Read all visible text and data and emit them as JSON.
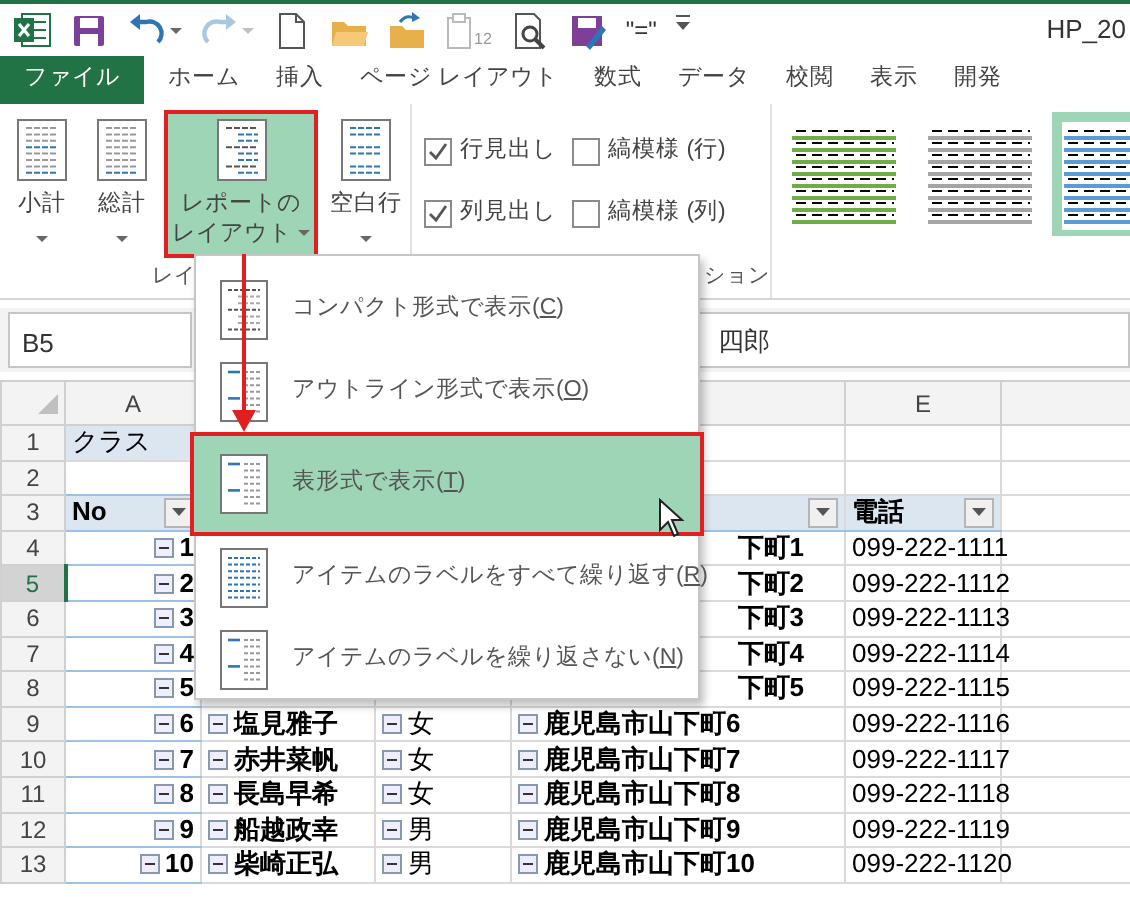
{
  "quick_access": {
    "tools": [
      {
        "kind": "excel"
      },
      {
        "kind": "save"
      },
      {
        "kind": "undo",
        "caret": true
      },
      {
        "kind": "redo",
        "caret": true,
        "disabled": true
      },
      {
        "kind": "new"
      },
      {
        "kind": "open"
      },
      {
        "kind": "folder-up"
      },
      {
        "kind": "clipboard",
        "disabled": true,
        "text": "12"
      },
      {
        "kind": "preview"
      },
      {
        "kind": "form"
      },
      {
        "kind": "text",
        "text": "\"=\""
      },
      {
        "kind": "customize"
      }
    ],
    "title": "HP_20"
  },
  "tabs": [
    {
      "label": "ファイル",
      "kind": "file"
    },
    {
      "label": "ホーム",
      "kind": "tab"
    },
    {
      "label": "挿入",
      "kind": "tab"
    },
    {
      "label": "ページ レイアウト",
      "kind": "tab"
    },
    {
      "label": "数式",
      "kind": "tab"
    },
    {
      "label": "データ",
      "kind": "tab"
    },
    {
      "label": "校閲",
      "kind": "tab"
    },
    {
      "label": "表示",
      "kind": "tab"
    },
    {
      "label": "開発",
      "kind": "tab"
    }
  ],
  "ribbon": {
    "buttons": [
      {
        "label": [
          "小計"
        ],
        "caret": true,
        "selected": false
      },
      {
        "label": [
          "総計"
        ],
        "caret": true,
        "selected": false
      },
      {
        "label": [
          "レポートの",
          "レイアウト"
        ],
        "caret": true,
        "selected": true
      },
      {
        "label": [
          "空白行"
        ],
        "caret": true,
        "selected": false
      }
    ],
    "group_label_1": "レイ",
    "checkboxes": [
      {
        "label": "行見出し",
        "checked": true
      },
      {
        "label": "縞模様 (行)",
        "checked": false
      },
      {
        "label": "列見出し",
        "checked": true
      },
      {
        "label": "縞模様 (列)",
        "checked": false
      }
    ],
    "group_label_2": "ション",
    "styles": [
      {
        "color": "#70ad47",
        "selected": false
      },
      {
        "color": "#a5a5a5",
        "selected": false
      },
      {
        "color": "#5b9bd5",
        "selected": true
      }
    ]
  },
  "menu": {
    "items": [
      {
        "kind": "compact",
        "parts": [
          "コンパクト形式で表示(",
          "C",
          ")"
        ],
        "selected": false
      },
      {
        "kind": "outline",
        "parts": [
          "アウトライン形式で表示(",
          "O",
          ")"
        ],
        "selected": false
      },
      {
        "kind": "tabular",
        "parts": [
          "表形式で表示(",
          "T",
          ")"
        ],
        "selected": true
      },
      {
        "kind": "repeat",
        "parts": [
          "アイテムのラベルをすべて繰り返す(",
          "R",
          ")"
        ],
        "selected": false
      },
      {
        "kind": "norepeat",
        "parts": [
          "アイテムのラベルを繰り返さない(",
          "N",
          ")"
        ],
        "selected": false
      }
    ]
  },
  "formula_bar": {
    "name_box": "B5",
    "content": "四郎"
  },
  "sheet": {
    "columns": [
      {
        "letter": "A"
      },
      {},
      {},
      {},
      {
        "letter": "E"
      },
      {}
    ],
    "rows": [
      {
        "number": "1",
        "selected": false,
        "kind": "label",
        "cells": [
          {
            "text": "クラス"
          },
          {},
          {},
          {},
          {},
          {}
        ]
      },
      {
        "number": "2",
        "selected": false,
        "kind": "data",
        "cells": [
          {},
          {},
          {},
          {},
          {},
          {}
        ]
      },
      {
        "number": "3",
        "selected": false,
        "kind": "header",
        "cells": [
          {
            "text": "No",
            "bold": true,
            "filter": true
          },
          {},
          {},
          {
            "filter": true
          },
          {
            "text": "電話",
            "bold": true,
            "filter": true
          },
          {}
        ]
      },
      {
        "number": "4",
        "selected": false,
        "kind": "data",
        "cells": [
          {
            "text": "1",
            "bold": true,
            "outline": true
          },
          {},
          {},
          {
            "text": "下町1",
            "bold": true,
            "partial": true
          },
          {
            "text": "099-222-1111"
          },
          {}
        ]
      },
      {
        "number": "5",
        "selected": true,
        "kind": "data",
        "cells": [
          {
            "text": "2",
            "bold": true,
            "outline": true
          },
          {},
          {},
          {
            "text": "下町2",
            "bold": true,
            "partial": true
          },
          {
            "text": "099-222-1112"
          },
          {}
        ]
      },
      {
        "number": "6",
        "selected": false,
        "kind": "data",
        "cells": [
          {
            "text": "3",
            "bold": true,
            "outline": true
          },
          {},
          {},
          {
            "text": "下町3",
            "bold": true,
            "partial": true
          },
          {
            "text": "099-222-1113"
          },
          {}
        ]
      },
      {
        "number": "7",
        "selected": false,
        "kind": "data",
        "cells": [
          {
            "text": "4",
            "bold": true,
            "outline": true
          },
          {},
          {},
          {
            "text": "下町4",
            "bold": true,
            "partial": true
          },
          {
            "text": "099-222-1114"
          },
          {}
        ]
      },
      {
        "number": "8",
        "selected": false,
        "kind": "data",
        "cells": [
          {
            "text": "5",
            "bold": true,
            "outline": true
          },
          {},
          {},
          {
            "text": "下町5",
            "bold": true,
            "partial": true
          },
          {
            "text": "099-222-1115"
          },
          {}
        ]
      },
      {
        "number": "9",
        "selected": false,
        "kind": "data",
        "cells": [
          {
            "text": "6",
            "bold": true,
            "outline": true
          },
          {
            "text": "塩見雅子",
            "bold": true,
            "outline": true
          },
          {
            "text": "女",
            "outline": true
          },
          {
            "text": "鹿児島市山下町6",
            "bold": true,
            "outline": true
          },
          {
            "text": "099-222-1116"
          },
          {}
        ]
      },
      {
        "number": "10",
        "selected": false,
        "kind": "data",
        "cells": [
          {
            "text": "7",
            "bold": true,
            "outline": true
          },
          {
            "text": "赤井菜帆",
            "bold": true,
            "outline": true
          },
          {
            "text": "女",
            "outline": true
          },
          {
            "text": "鹿児島市山下町7",
            "bold": true,
            "outline": true
          },
          {
            "text": "099-222-1117"
          },
          {}
        ]
      },
      {
        "number": "11",
        "selected": false,
        "kind": "data",
        "cells": [
          {
            "text": "8",
            "bold": true,
            "outline": true
          },
          {
            "text": "長島早希",
            "bold": true,
            "outline": true
          },
          {
            "text": "女",
            "outline": true
          },
          {
            "text": "鹿児島市山下町8",
            "bold": true,
            "outline": true
          },
          {
            "text": "099-222-1118"
          },
          {}
        ]
      },
      {
        "number": "12",
        "selected": false,
        "kind": "data",
        "cells": [
          {
            "text": "9",
            "bold": true,
            "outline": true
          },
          {
            "text": "船越政幸",
            "bold": true,
            "outline": true
          },
          {
            "text": "男",
            "outline": true
          },
          {
            "text": "鹿児島市山下町9",
            "bold": true,
            "outline": true
          },
          {
            "text": "099-222-1119"
          },
          {}
        ]
      },
      {
        "number": "13",
        "selected": false,
        "kind": "data",
        "cells": [
          {
            "text": "10",
            "bold": true,
            "outline": true
          },
          {
            "text": "柴崎正弘",
            "bold": true,
            "outline": true
          },
          {
            "text": "男",
            "outline": true
          },
          {
            "text": "鹿児島市山下町10",
            "bold": true,
            "outline": true
          },
          {
            "text": "099-222-1120"
          },
          {}
        ]
      }
    ]
  }
}
